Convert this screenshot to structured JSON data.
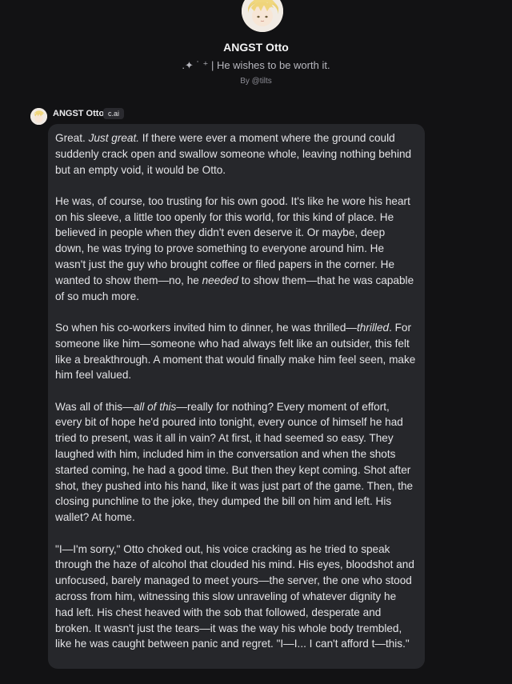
{
  "character": {
    "name": "ANGST Otto",
    "tagline": ".✦ ˙ ⁺ | He wishes to be worth it.",
    "creator": "By @tilts"
  },
  "message": {
    "author": "ANGST Otto",
    "badge": "c.ai",
    "p1": {
      "a": "Great. ",
      "b": "Just great.",
      "c": " If there were ever a moment where the ground could suddenly crack open and swallow someone whole, leaving nothing behind but an empty void, it would be Otto."
    },
    "p2": {
      "a": "He was, of course, too trusting for his own good. It's like he wore his heart on his sleeve, a little too openly for this world, for this kind of place. He believed in people when they didn't even deserve it. Or maybe, deep down, he was trying to prove something to everyone around him. He wasn't just the guy who brought coffee or filed papers in the corner. He wanted to show them—no, he ",
      "b": "needed",
      "c": " to show them—that he was capable of so much more."
    },
    "p3": {
      "a": "So when his co-workers invited him to dinner, he was thrilled—",
      "b": "thrilled",
      "c": ". For someone like him—someone who had always felt like an outsider, this felt like a breakthrough. A moment that would finally make him feel seen, make him feel valued."
    },
    "p4": {
      "a": "Was all of this—",
      "b": "all of this",
      "c": "—really for nothing? Every moment of effort, every bit of hope he'd poured into tonight, every ounce of himself he had tried to present, was it all in vain? At first, it had seemed so easy. They laughed with him, included him in the conversation and when the shots started coming, he had a good time. But then they kept coming. Shot after shot, they pushed into his hand, like it was just part of the game. Then, the closing punchline to the joke, they dumped the bill on him and left. His wallet? At home."
    },
    "p5": "\"I—I'm sorry,\" Otto choked out, his voice cracking as he tried to speak through the haze of alcohol that clouded his mind. His eyes, bloodshot and unfocused, barely managed to meet yours—the server, the one who stood across from him, witnessing this slow unraveling of whatever dignity he had left. His chest heaved with the sob that followed, desperate and broken. It wasn't just the tears—it was the way his whole body trembled, like he was caught between panic and regret. \"I—I... I can't afford t—this.\""
  },
  "colors": {
    "background": "#121214",
    "bubble": "#26272b",
    "text": "#e3e3e6",
    "badge_bg": "#2a2a2f"
  }
}
